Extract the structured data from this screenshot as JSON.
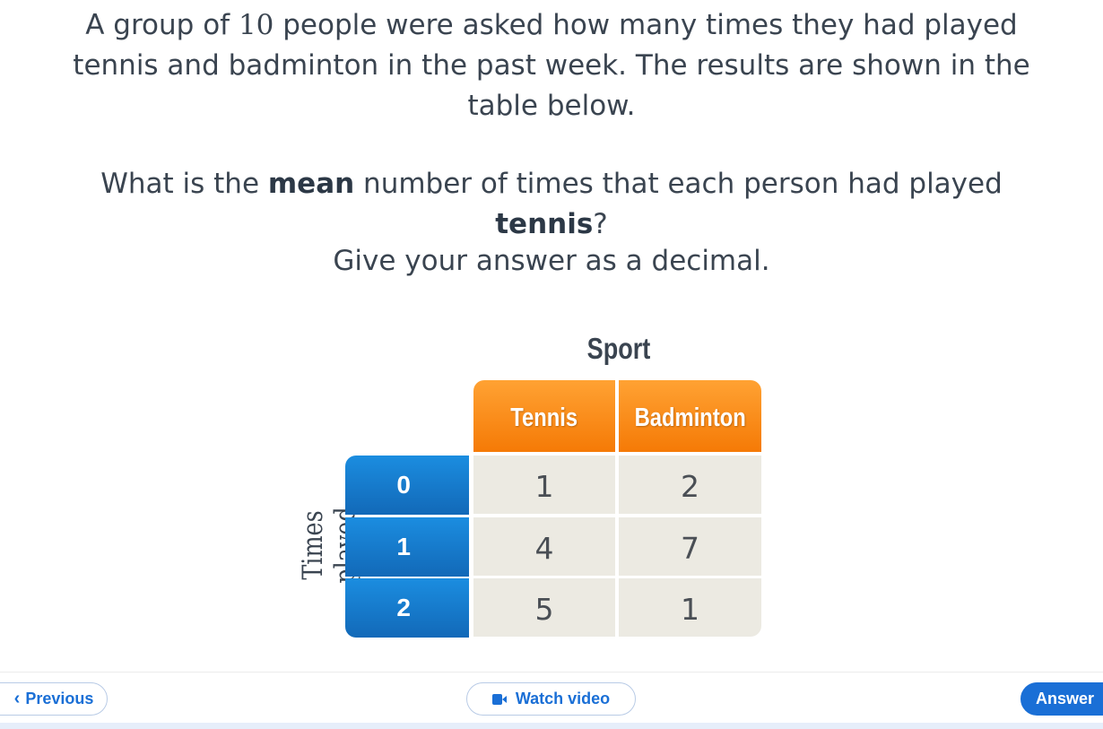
{
  "question": {
    "intro_before_number": "A group of ",
    "number": "10",
    "intro_line1_after": " people were asked how many times they had played",
    "intro_line2": "tennis and badminton in the past week. The results are shown in the",
    "intro_line3": "table below.",
    "ask_before_bold": "What is the ",
    "ask_bold_mean": "mean",
    "ask_after_bold": " number of times that each person had played",
    "ask_bold_tennis": "tennis",
    "ask_question_mark": "?",
    "instruction": "Give your answer as a decimal."
  },
  "table": {
    "column_group_title": "Sport",
    "row_group_title": "Times played",
    "columns": [
      "Tennis",
      "Badminton"
    ],
    "rows": [
      {
        "label": "0",
        "values": [
          "1",
          "2"
        ]
      },
      {
        "label": "1",
        "values": [
          "4",
          "7"
        ]
      },
      {
        "label": "2",
        "values": [
          "5",
          "1"
        ]
      }
    ],
    "header_color": "#f5860f",
    "row_header_color": "#167bcc",
    "cell_color": "#eceae2"
  },
  "footer": {
    "previous_label": "Previous",
    "watch_video_label": "Watch video",
    "answer_label": "Answer",
    "accent_color": "#1a6fd6",
    "previous_icon": "chevron-left-icon",
    "watch_icon": "video-camera-icon"
  }
}
